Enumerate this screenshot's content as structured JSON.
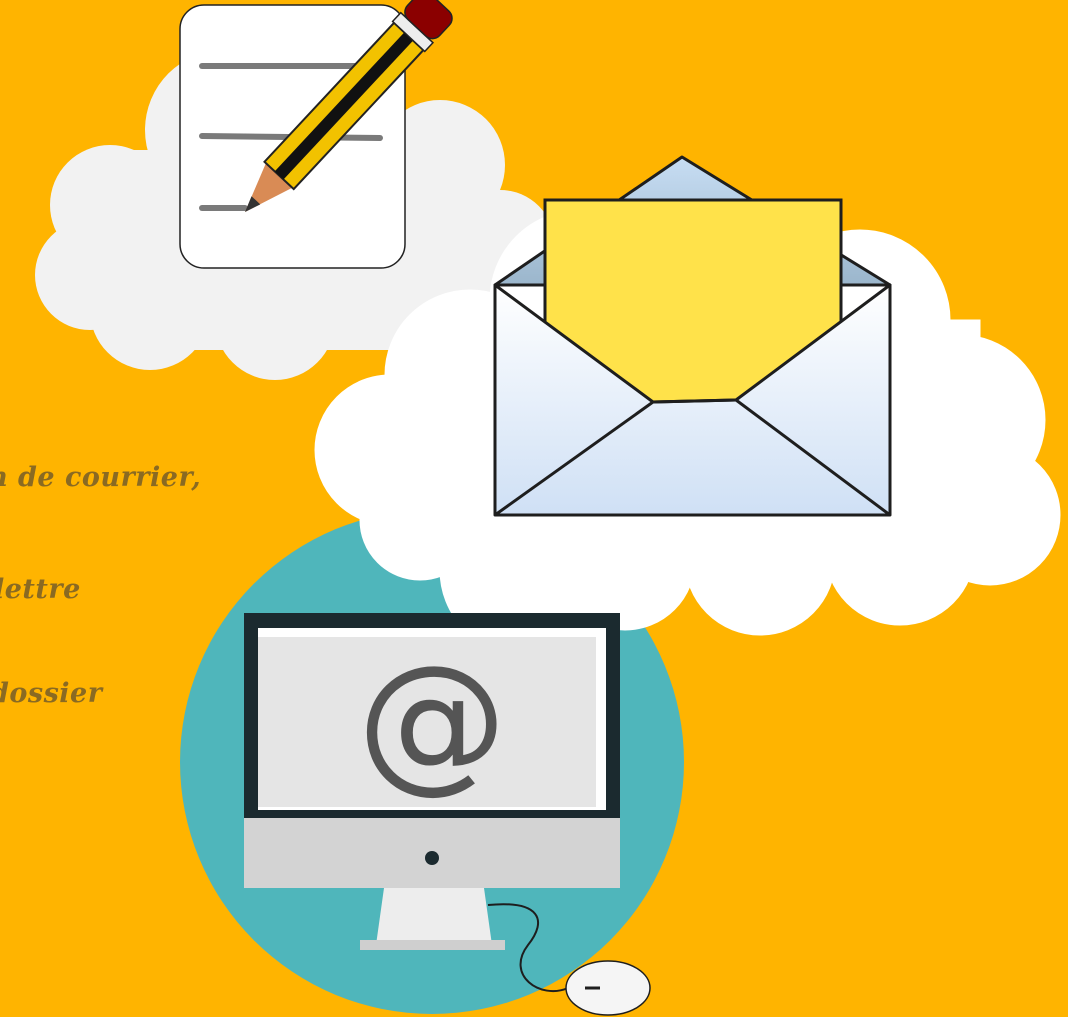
{
  "text_lines": [
    "n de courrier,",
    "lettre",
    "dossier"
  ],
  "monitor": {
    "screen_symbol": "@"
  },
  "icons": {
    "notepad": "notepad-pencil-icon",
    "envelope": "open-envelope-icon",
    "computer": "desktop-computer-icon",
    "mouse": "mouse-icon"
  },
  "colors": {
    "background": "#FFB400",
    "cloud": "#F2F2F2",
    "circle": "#4FB6BB",
    "letter": "#FFE24A",
    "text": "#8A6A22"
  }
}
